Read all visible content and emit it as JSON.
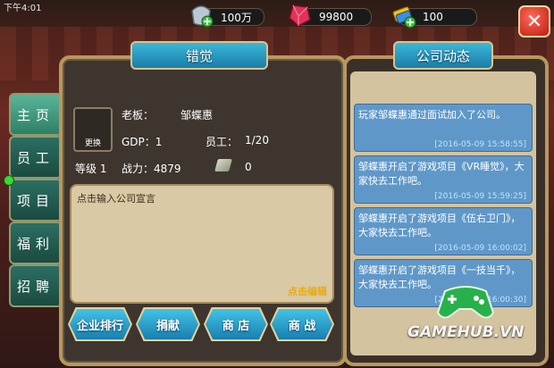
{
  "status_bar": {
    "time": "下午4:01"
  },
  "resources": [
    {
      "icon": "silver-coin-icon",
      "value": "100万"
    },
    {
      "icon": "ruby-gem-icon",
      "value": "99800"
    },
    {
      "icon": "gold-ticket-icon",
      "value": "100"
    }
  ],
  "left_panel": {
    "title": "错觉",
    "boss_label": "老板：",
    "boss_name": "邹蝶惠",
    "avatar_button": "更换",
    "gdp": "GDP：1",
    "staff": "员工：",
    "staff_count": "1/20",
    "level": "等级 1",
    "power": "战力：4879",
    "stone_count": "0",
    "slogan_placeholder": "点击输入公司宣言",
    "edit_label": "点击编辑"
  },
  "buttons": [
    "企业排行",
    "捐献",
    "商 店",
    "商 战"
  ],
  "side_tabs": [
    "主页",
    "员工",
    "项目",
    "福利",
    "招聘"
  ],
  "right_panel": {
    "title": "公司动态",
    "messages": [
      {
        "text": "玩家邹蝶惠通过面试加入了公司。",
        "time": "[2016-05-09 15:58:55]"
      },
      {
        "text": "邹蝶惠开启了游戏项目《VR睡觉》，大家快去工作吧。",
        "time": "[2016-05-09 15:59:25]"
      },
      {
        "text": "邹蝶惠开启了游戏项目《伍右卫门》，大家快去工作吧。",
        "time": "[2016-05-09 16:00:02]"
      },
      {
        "text": "邹蝶惠开启了游戏项目《一技当千》，大家快去工作吧。",
        "time": "[2016-05-09 16:00:30]"
      }
    ]
  },
  "watermark": "GAMEHUB.VN"
}
